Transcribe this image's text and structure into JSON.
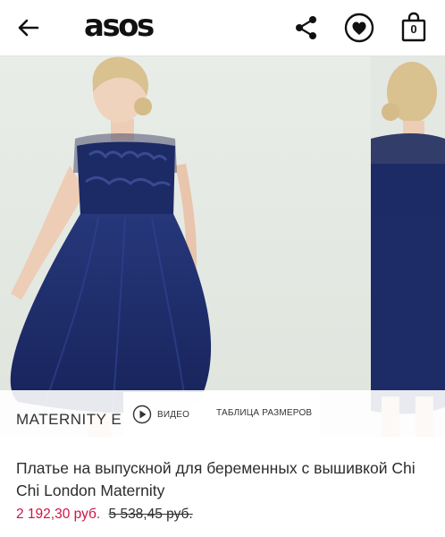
{
  "header": {
    "logo": "asos",
    "bag_count": "0",
    "icons": [
      "back-arrow-icon",
      "share-icon",
      "heart-icon",
      "shopping-bag-icon"
    ]
  },
  "gallery": {
    "brand_badge": "MATERNITY E",
    "video_label": "ВИДЕО",
    "size_chart_label": "ТАБЛИЦА РАЗМЕРОВ"
  },
  "product": {
    "title": "Платье на выпускной для беременных с вышивкой Chi Chi London Maternity",
    "price_current": "2 192,30 руб.",
    "price_old": "5 538,45 руб."
  },
  "colors": {
    "sale_price": "#d01345",
    "dress_navy": "#1c2a66",
    "background_mint": "#e7ebe6"
  }
}
